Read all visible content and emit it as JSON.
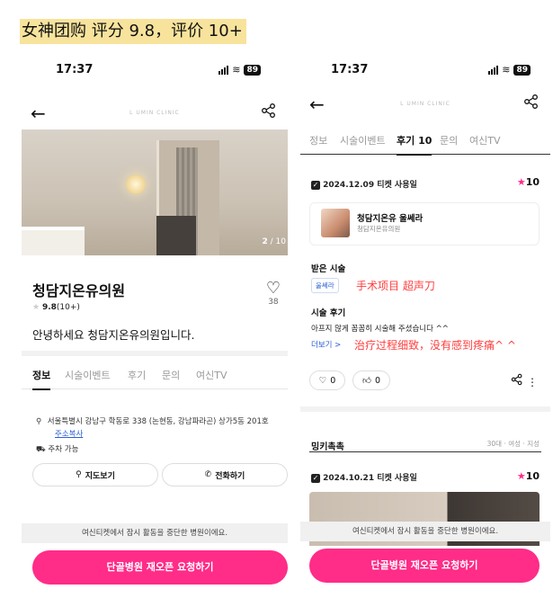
{
  "caption": "女神团购 评分 9.8，评价 10+",
  "left": {
    "status": {
      "time": "17:37",
      "battery": "89"
    },
    "logo": "L UMIN CLINIC",
    "image_counter": {
      "current": "2",
      "total": "/ 10"
    },
    "clinic_name": "청담지온유의원",
    "rating": "9.8",
    "rating_count": "(10+)",
    "likes": "38",
    "intro": "안녕하세요 청담지온유의원입니다.",
    "tabs": [
      "정보",
      "시술이벤트",
      "후기",
      "문의",
      "여신TV"
    ],
    "address": "서울특별시 강남구 학동로 338 (논현동, 강남파라곤) 상가5동 201호",
    "copy_address": "주소복사",
    "parking": "주차 가능",
    "map_button": "지도보기",
    "call_button": "전화하기",
    "notice": "여신티켓에서 잠시 활동을 중단한 병원이에요.",
    "cta": "단골병원 재오픈 요청하기"
  },
  "right": {
    "status": {
      "time": "17:37",
      "battery": "89"
    },
    "logo": "L UMIN CLINIC",
    "tabs": [
      "정보",
      "시술이벤트",
      "후기",
      "10",
      "문의",
      "여신TV"
    ],
    "review1": {
      "date": "2024.12.09",
      "ticket": "티켓 사용일",
      "score": "10",
      "doctor_name": "청담지온유 울쎄라",
      "doctor_clinic": "청담지온유의원",
      "received_label": "받은 시술",
      "procedure_chip": "울쎄라",
      "procedure_note": "手术项目 超声刀",
      "review_label": "시술 후기",
      "review_text": "아프지 않게 꼼꼼히 시술해 주셨습니다 ^^",
      "more": "더보기 >",
      "review_note": "治疗过程细致，没有感到疼痛^ ^",
      "likes": "0",
      "thumbs": "0"
    },
    "review2": {
      "user": "밍키촉촉",
      "meta": "30대 · 여성 · 지성",
      "date": "2024.10.21",
      "ticket": "티켓 사용일",
      "score": "10"
    },
    "notice": "여신티켓에서 잠시 활동을 중단한 병원이에요.",
    "cta": "단골병원 재오픈 요청하기"
  }
}
